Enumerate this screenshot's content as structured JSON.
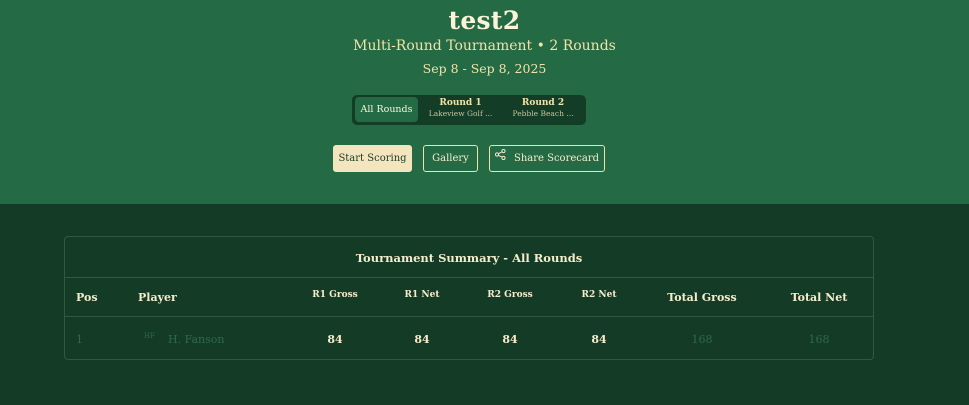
{
  "header": {
    "title": "test2",
    "subtitle": "Multi-Round Tournament • 2 Rounds",
    "dates": "Sep 8 - Sep 8, 2025"
  },
  "tabs": {
    "all_label": "All Rounds",
    "rounds": [
      {
        "label": "Round 1",
        "course": "Lakeview Golf ..."
      },
      {
        "label": "Round 2",
        "course": "Pebble Beach ..."
      }
    ]
  },
  "actions": {
    "start_label": "Start Scoring",
    "gallery_label": "Gallery",
    "share_label": "Share Scorecard",
    "share_icon": "share-icon"
  },
  "summary": {
    "title": "Tournament Summary - All Rounds",
    "columns": {
      "pos": "Pos",
      "player": "Player",
      "r1_gross": "R1 Gross",
      "r1_net": "R1 Net",
      "r2_gross": "R2 Gross",
      "r2_net": "R2 Net",
      "total_gross": "Total Gross",
      "total_net": "Total Net"
    },
    "rows": [
      {
        "pos": "1",
        "initials": "HF",
        "player": "H. Fanson",
        "r1_gross": "84",
        "r1_net": "84",
        "r2_gross": "84",
        "r2_net": "84",
        "total_gross": "168",
        "total_net": "168"
      }
    ]
  },
  "colors": {
    "header_bg": "#236a45",
    "page_bg": "#133b26",
    "accent": "#f3e5bd"
  }
}
